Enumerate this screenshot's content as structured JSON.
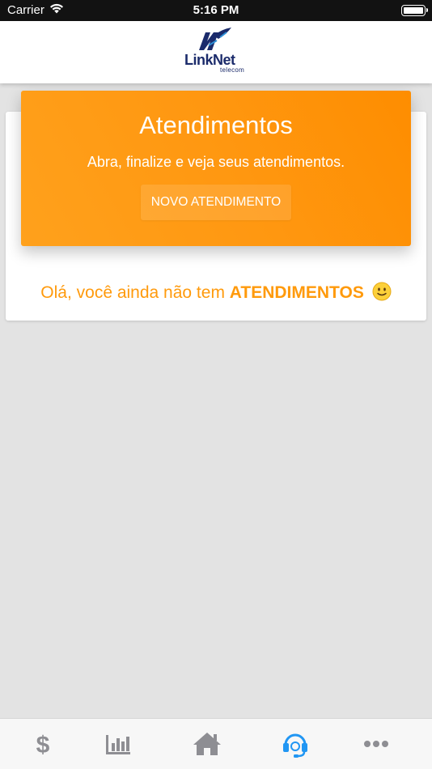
{
  "status_bar": {
    "carrier": "Carrier",
    "time": "5:16 PM"
  },
  "header": {
    "logo_text": "LinkNet",
    "logo_subtext": "telecom",
    "brand_color": "#1b2b6b"
  },
  "hero": {
    "title": "Atendimentos",
    "subtitle": "Abra, finalize e veja seus atendimentos.",
    "new_button_label": "NOVO ATENDIMENTO",
    "gradient_colors": [
      "#ffa11c",
      "#fe8d00"
    ]
  },
  "empty_state": {
    "prefix": "Olá, você ainda não tem",
    "highlight": "ATENDIMENTOS",
    "emoji": "slightly-smiling-face-icon",
    "color": "#ff9a0c"
  },
  "tab_bar": {
    "active_color": "#2196f3",
    "inactive_color": "#8e8e93",
    "tabs": [
      {
        "icon": "dollar-icon",
        "active": false
      },
      {
        "icon": "bar-chart-icon",
        "active": false
      },
      {
        "icon": "home-icon",
        "active": false
      },
      {
        "icon": "headset-icon",
        "active": true
      },
      {
        "icon": "more-icon",
        "active": false
      }
    ]
  }
}
